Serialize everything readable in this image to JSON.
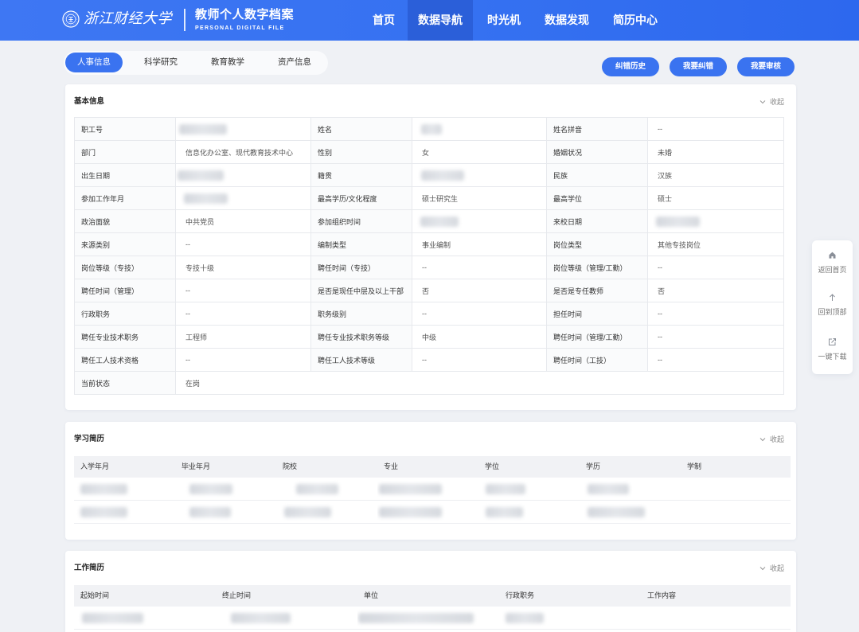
{
  "header": {
    "logo_text": "浙江财经大学",
    "app_title": "教师个人数字档案",
    "app_subtitle": "PERSONAL DIGITAL FILE",
    "nav": [
      {
        "label": "首页",
        "active": false
      },
      {
        "label": "数据导航",
        "active": true
      },
      {
        "label": "时光机",
        "active": false
      },
      {
        "label": "数据发现",
        "active": false
      },
      {
        "label": "简历中心",
        "active": false
      }
    ]
  },
  "tabs": [
    {
      "label": "人事信息",
      "active": true
    },
    {
      "label": "科学研究",
      "active": false
    },
    {
      "label": "教育教学",
      "active": false
    },
    {
      "label": "资产信息",
      "active": false
    }
  ],
  "actions": {
    "correction_history": "纠错历史",
    "submit_correction": "我要纠错",
    "submit_review": "我要审核"
  },
  "basic_info": {
    "title": "基本信息",
    "collapse_label": "收起",
    "rows": [
      [
        {
          "label": "职工号",
          "redacted": true
        },
        {
          "label": "姓名",
          "redacted": true
        },
        {
          "label": "姓名拼音",
          "value": "--"
        }
      ],
      [
        {
          "label": "部门",
          "value": "信息化办公室、现代教育技术中心"
        },
        {
          "label": "性别",
          "value": "女"
        },
        {
          "label": "婚姻状况",
          "value": "未婚"
        }
      ],
      [
        {
          "label": "出生日期",
          "redacted": true
        },
        {
          "label": "籍贯",
          "redacted": true
        },
        {
          "label": "民族",
          "value": "汉族"
        }
      ],
      [
        {
          "label": "参加工作年月",
          "redacted": true
        },
        {
          "label": "最高学历/文化程度",
          "value": "硕士研究生"
        },
        {
          "label": "最高学位",
          "value": "硕士"
        }
      ],
      [
        {
          "label": "政治面貌",
          "value": "中共党员"
        },
        {
          "label": "参加组织时间",
          "redacted": true
        },
        {
          "label": "来校日期",
          "redacted": true
        }
      ],
      [
        {
          "label": "来源类别",
          "value": "--"
        },
        {
          "label": "编制类型",
          "value": "事业编制"
        },
        {
          "label": "岗位类型",
          "value": "其他专技岗位"
        }
      ],
      [
        {
          "label": "岗位等级（专技）",
          "value": "专技十级"
        },
        {
          "label": "聘任时间（专技）",
          "value": "--"
        },
        {
          "label": "岗位等级（管理/工勤）",
          "value": "--"
        }
      ],
      [
        {
          "label": "聘任时间（管理）",
          "value": "--"
        },
        {
          "label": "是否是现任中层及以上干部",
          "value": "否"
        },
        {
          "label": "是否是专任教师",
          "value": "否"
        }
      ],
      [
        {
          "label": "行政职务",
          "value": "--"
        },
        {
          "label": "职务级别",
          "value": "--"
        },
        {
          "label": "担任时间",
          "value": "--"
        }
      ],
      [
        {
          "label": "聘任专业技术职务",
          "value": "工程师"
        },
        {
          "label": "聘任专业技术职务等级",
          "value": "中级"
        },
        {
          "label": "聘任时间（管理/工勤）",
          "value": "--"
        }
      ],
      [
        {
          "label": "聘任工人技术资格",
          "value": "--"
        },
        {
          "label": "聘任工人技术等级",
          "value": "--"
        },
        {
          "label": "聘任时间（工技）",
          "value": "--"
        }
      ],
      [
        {
          "label": "当前状态",
          "value": "在岗"
        }
      ]
    ]
  },
  "study_history": {
    "title": "学习简历",
    "collapse_label": "收起",
    "columns": [
      "入学年月",
      "毕业年月",
      "院校",
      "专业",
      "学位",
      "学历",
      "学制"
    ],
    "rows": [
      [
        {
          "redacted": true
        },
        {
          "redacted": true
        },
        {
          "redacted": true
        },
        {
          "redacted": true
        },
        {
          "redacted": true
        },
        {
          "redacted": true
        },
        null
      ],
      [
        {
          "redacted": true
        },
        {
          "redacted": true
        },
        {
          "redacted": true
        },
        {
          "redacted": true
        },
        {
          "redacted": true
        },
        {
          "redacted": true
        },
        null
      ]
    ]
  },
  "work_history": {
    "title": "工作简历",
    "collapse_label": "收起",
    "columns": [
      "起始时间",
      "终止时间",
      "单位",
      "行政职务",
      "工作内容"
    ],
    "rows": [
      [
        {
          "redacted": true
        },
        {
          "redacted": true
        },
        {
          "redacted": true
        },
        {
          "redacted": true
        },
        null
      ]
    ]
  },
  "side_tools": [
    {
      "label": "返回首页",
      "icon": "home-icon"
    },
    {
      "label": "回到顶部",
      "icon": "arrow-up-icon"
    },
    {
      "label": "一键下载",
      "icon": "export-icon"
    }
  ],
  "colors": {
    "primary": "#3a73f0",
    "nav_active": "#2b5fd9",
    "header_start": "#3e77f3",
    "header_end": "#2d68ee"
  }
}
